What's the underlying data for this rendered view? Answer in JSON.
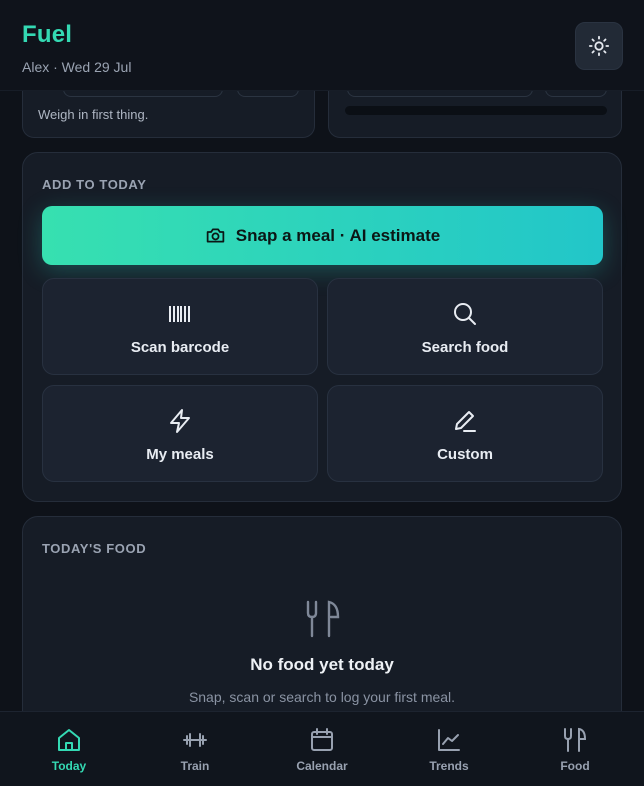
{
  "header": {
    "app_title": "Fuel",
    "subtitle": "Alex · Wed 29 Jul",
    "theme_toggle_icon": "sun-icon"
  },
  "weigh_card": {
    "hint": "Weigh in first thing."
  },
  "add_to_today": {
    "title": "ADD TO TODAY",
    "snap_label": "Snap a meal · AI estimate",
    "snap_icon": "camera-icon",
    "tiles": [
      {
        "label": "Scan barcode",
        "icon": "barcode-icon"
      },
      {
        "label": "Search food",
        "icon": "search-icon"
      },
      {
        "label": "My meals",
        "icon": "lightning-icon"
      },
      {
        "label": "Custom",
        "icon": "pencil-icon"
      }
    ]
  },
  "todays_food": {
    "title": "TODAY'S FOOD",
    "empty_icon": "fork-knife-icon",
    "empty_title": "No food yet today",
    "empty_subtitle": "Snap, scan or search to log your first meal."
  },
  "bottom_nav": {
    "active": "Today",
    "items": [
      {
        "label": "Today",
        "icon": "home-icon"
      },
      {
        "label": "Train",
        "icon": "dumbbell-icon"
      },
      {
        "label": "Calendar",
        "icon": "calendar-icon"
      },
      {
        "label": "Trends",
        "icon": "chart-icon"
      },
      {
        "label": "Food",
        "icon": "fork-knife-icon"
      }
    ]
  },
  "colors": {
    "accent": "#34d9b3",
    "accent_gradient_end": "#22c6c9",
    "background": "#0e1219",
    "card": "#161c26",
    "tile": "#1c2330"
  }
}
